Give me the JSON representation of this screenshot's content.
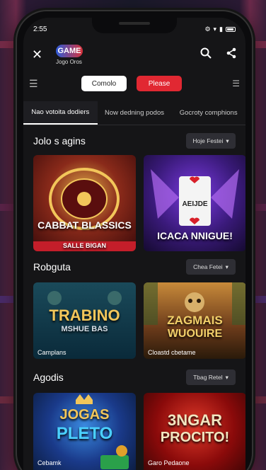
{
  "status": {
    "time": "2:55"
  },
  "app": {
    "logo_mark": "GAME",
    "logo_text": "Jogo Oros"
  },
  "filters": {
    "left_pill": "Comolo",
    "right_pill": "Please"
  },
  "tabs": [
    {
      "label": "Nao votoita dodiers",
      "active": true
    },
    {
      "label": "Now dedning podos",
      "active": false
    },
    {
      "label": "Gocroty comphions",
      "active": false
    }
  ],
  "sections": [
    {
      "title": "Jolo s agins",
      "see_all": "Hoje Festei",
      "tiles": [
        {
          "title": "CABBAT BLASSICS",
          "subtitle": "SALLE BIGAN",
          "caption": ""
        },
        {
          "title": "ICACA NNIGUE!",
          "subtitle": "AEIJDE",
          "caption": ""
        }
      ]
    },
    {
      "title": "Robguta",
      "see_all": "Chea Fetei",
      "tiles": [
        {
          "title": "TRABINO",
          "subtitle": "MSHUE BAS",
          "caption": "Camplans"
        },
        {
          "title": "ZAGMAIS",
          "subtitle": "WUOUIRE",
          "caption": "Cloastd cbetame"
        }
      ]
    },
    {
      "title": "Agodis",
      "see_all": "Tbag Retel",
      "tiles": [
        {
          "title": "JOGAS",
          "subtitle": "PLETO",
          "caption": "Cebamk"
        },
        {
          "title": "3NGAR",
          "subtitle": "PROCITO!",
          "caption": "Garo Pedaone"
        }
      ]
    }
  ]
}
